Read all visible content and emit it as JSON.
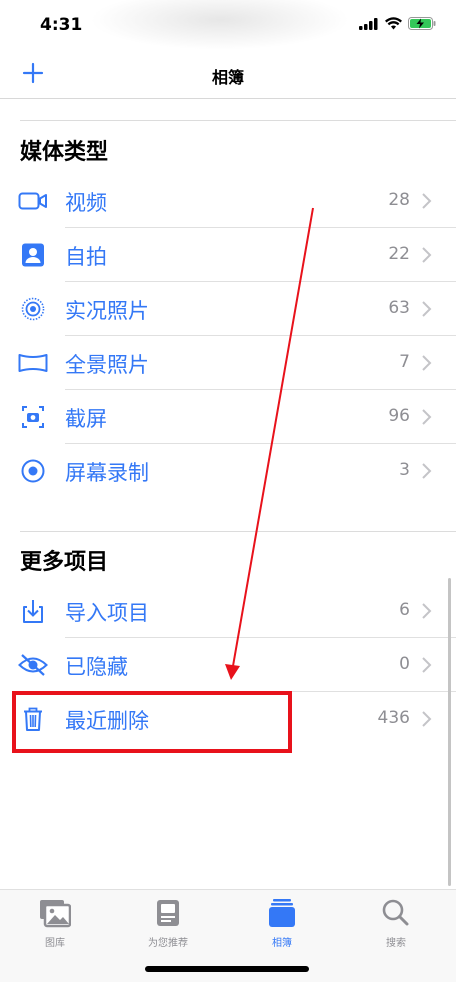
{
  "status": {
    "time": "4:31"
  },
  "nav": {
    "title": "相簿"
  },
  "media_types": {
    "title": "媒体类型",
    "items": [
      {
        "label": "视频",
        "count": "28",
        "icon": "video-icon"
      },
      {
        "label": "自拍",
        "count": "22",
        "icon": "selfie-portrait-icon"
      },
      {
        "label": "实况照片",
        "count": "63",
        "icon": "live-photo-icon"
      },
      {
        "label": "全景照片",
        "count": "7",
        "icon": "panorama-icon"
      },
      {
        "label": "截屏",
        "count": "96",
        "icon": "screenshot-icon"
      },
      {
        "label": "屏幕录制",
        "count": "3",
        "icon": "screen-recording-icon"
      }
    ]
  },
  "more_items": {
    "title": "更多项目",
    "items": [
      {
        "label": "导入项目",
        "count": "6",
        "icon": "import-icon"
      },
      {
        "label": "已隐藏",
        "count": "0",
        "icon": "hidden-eye-slash-icon"
      },
      {
        "label": "最近删除",
        "count": "436",
        "icon": "trash-icon"
      }
    ]
  },
  "tabs": [
    {
      "label": "图库",
      "icon": "photo-library-icon",
      "active": false
    },
    {
      "label": "为您推荐",
      "icon": "for-you-icon",
      "active": false
    },
    {
      "label": "相簿",
      "icon": "albums-icon",
      "active": true
    },
    {
      "label": "搜索",
      "icon": "search-icon",
      "active": false
    }
  ],
  "colors": {
    "accent": "#3478f6",
    "annotation": "#e8121b",
    "count_gray": "#8e8e93"
  }
}
